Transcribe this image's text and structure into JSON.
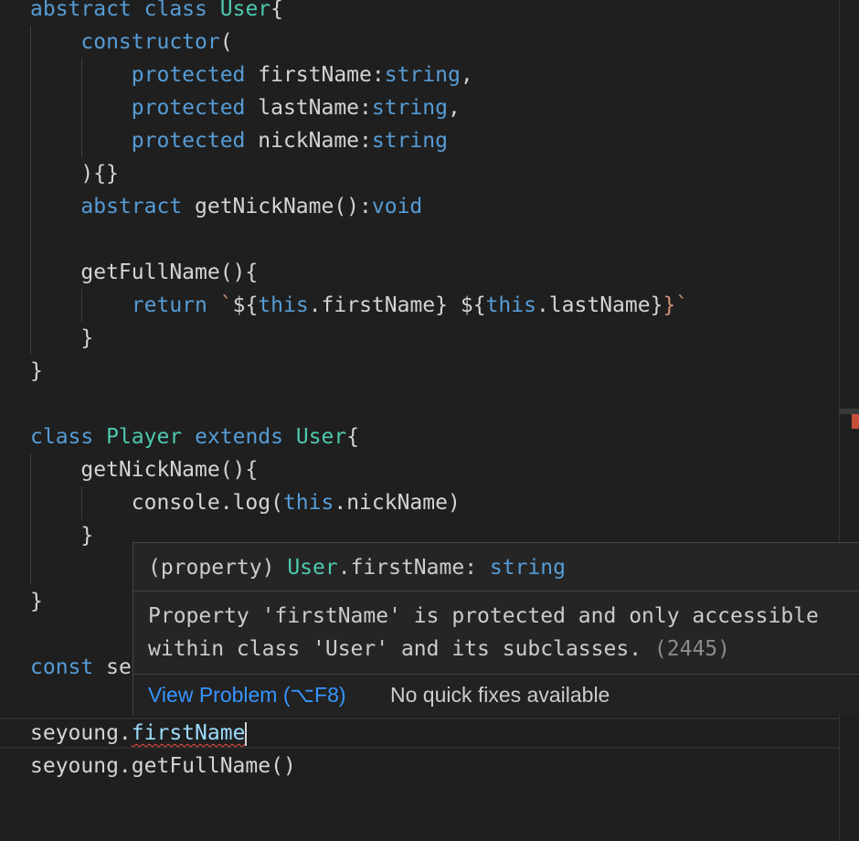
{
  "code_lines": [
    [
      {
        "t": "abstract",
        "c": "kw"
      },
      {
        "t": " "
      },
      {
        "t": "class",
        "c": "kw"
      },
      {
        "t": " "
      },
      {
        "t": "User",
        "c": "ty"
      },
      {
        "t": "{"
      }
    ],
    [
      {
        "t": "    "
      },
      {
        "t": "constructor",
        "c": "kw"
      },
      {
        "t": "("
      }
    ],
    [
      {
        "t": "        "
      },
      {
        "t": "protected",
        "c": "kw"
      },
      {
        "t": " firstName:"
      },
      {
        "t": "string",
        "c": "kw"
      },
      {
        "t": ","
      }
    ],
    [
      {
        "t": "        "
      },
      {
        "t": "protected",
        "c": "kw"
      },
      {
        "t": " lastName:"
      },
      {
        "t": "string",
        "c": "kw"
      },
      {
        "t": ","
      }
    ],
    [
      {
        "t": "        "
      },
      {
        "t": "protected",
        "c": "kw"
      },
      {
        "t": " nickName:"
      },
      {
        "t": "string",
        "c": "kw"
      }
    ],
    [
      {
        "t": "    ){}"
      }
    ],
    [
      {
        "t": "    "
      },
      {
        "t": "abstract",
        "c": "kw"
      },
      {
        "t": " getNickName():"
      },
      {
        "t": "void",
        "c": "kw"
      }
    ],
    [],
    [
      {
        "t": "    getFullName(){"
      }
    ],
    [
      {
        "t": "        "
      },
      {
        "t": "return",
        "c": "kw"
      },
      {
        "t": " "
      },
      {
        "t": "`",
        "c": "st"
      },
      {
        "t": "${"
      },
      {
        "t": "this",
        "c": "kw"
      },
      {
        "t": ".firstName} ${"
      },
      {
        "t": "this",
        "c": "kw"
      },
      {
        "t": ".lastName}"
      },
      {
        "t": "}`",
        "c": "st"
      }
    ],
    [
      {
        "t": "    }"
      }
    ],
    [
      {
        "t": "}"
      }
    ],
    [],
    [
      {
        "t": "class",
        "c": "kw"
      },
      {
        "t": " "
      },
      {
        "t": "Player",
        "c": "ty"
      },
      {
        "t": " "
      },
      {
        "t": "extends",
        "c": "kw"
      },
      {
        "t": " "
      },
      {
        "t": "User",
        "c": "ty"
      },
      {
        "t": "{"
      }
    ],
    [
      {
        "t": "    getNickName(){"
      }
    ],
    [
      {
        "t": "        console.log("
      },
      {
        "t": "this",
        "c": "kw"
      },
      {
        "t": ".nickName)"
      }
    ],
    [
      {
        "t": "    }"
      }
    ],
    [],
    [
      {
        "t": "}"
      }
    ],
    [],
    [
      {
        "t": "const",
        "c": "kw"
      },
      {
        "t": " se"
      }
    ],
    [],
    [
      {
        "t": "seyoung."
      },
      {
        "t": "firstName",
        "c": "err"
      },
      {
        "t": "",
        "c": "caret"
      }
    ],
    [
      {
        "t": "seyoung.getFullName()"
      }
    ]
  ],
  "hover": {
    "signature": [
      {
        "t": "(property) "
      },
      {
        "t": "User",
        "c": "ty"
      },
      {
        "t": ".firstName: "
      },
      {
        "t": "string",
        "c": "kw"
      }
    ],
    "message_line1": "Property 'firstName' is protected and only accessible",
    "message_line2": "within class 'User' and its subclasses.",
    "error_code": "(2445)",
    "view_problem_label": "View Problem (⌥F8)",
    "no_fixes_label": "No quick fixes available"
  },
  "colors": {
    "background": "#1f1f1f",
    "keyword": "#569cd6",
    "type": "#4ec9b0",
    "string": "#ce9178",
    "error_squiggle": "#f14c4c",
    "link": "#3794ff"
  }
}
